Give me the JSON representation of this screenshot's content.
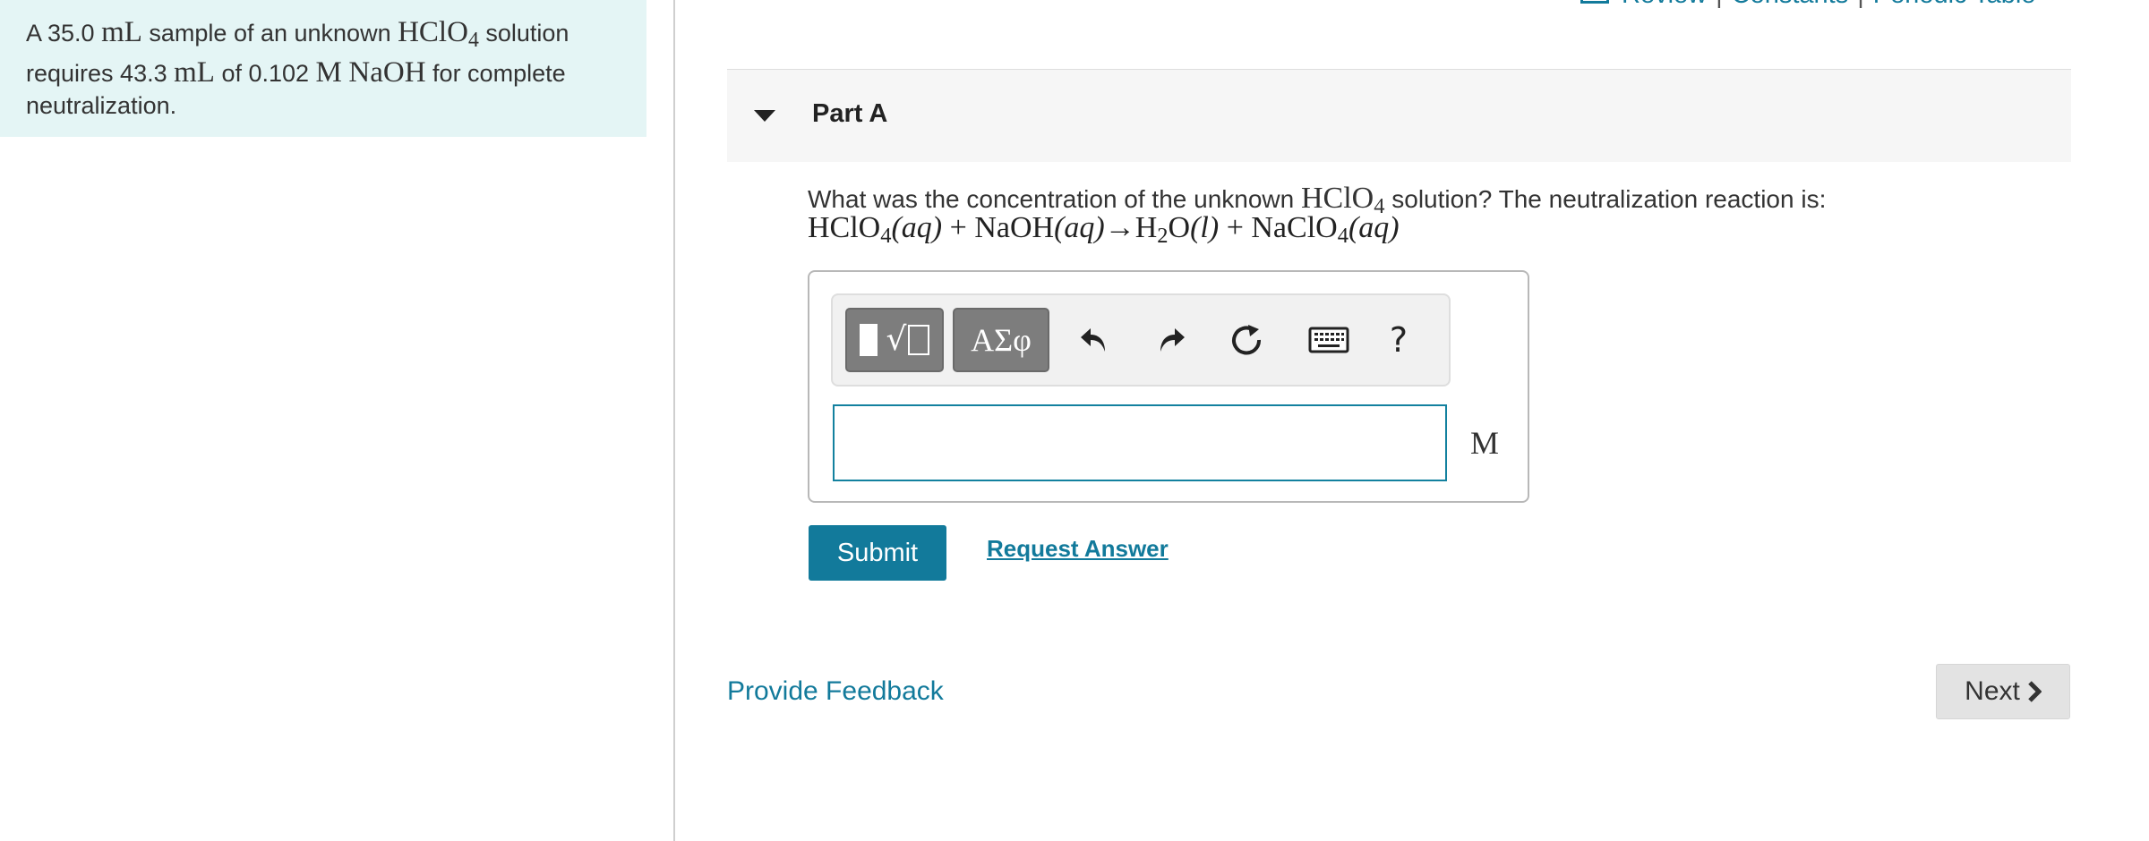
{
  "problem": {
    "t1": "A 35.0 ",
    "u1": "mL",
    "t2": " sample of an unknown ",
    "chem1": "HClO",
    "chem1_sub": "4",
    "t3": " solution requires 43.3 ",
    "u2": "mL",
    "t4": " of 0.102 ",
    "u3": "M",
    "t5": " ",
    "chem2": "NaOH",
    "t6": " for complete neutralization."
  },
  "top_links": {
    "review": "Review",
    "constants": "Constants",
    "periodic_table": "Periodic Table",
    "separator": "|"
  },
  "part": {
    "title": "Part A"
  },
  "question": {
    "t1": "What was the concentration of the unknown ",
    "chem": "HClO",
    "chem_sub": "4",
    "t2": " solution? The neutralization reaction is:"
  },
  "equation": {
    "r1": "HClO",
    "r1_sub": "4",
    "r1_state": "(aq)",
    "plus1": " + ",
    "r2": "NaOH",
    "r2_state": "(aq)",
    "arrow": "→",
    "p1": "H",
    "p1_sub": "2",
    "p1b": "O",
    "p1_state": "(l)",
    "plus2": " + ",
    "p2": "NaClO",
    "p2_sub": "4",
    "p2_state": "(aq)"
  },
  "toolbar": {
    "greek_label": "ΑΣφ",
    "help_label": "?"
  },
  "answer": {
    "value": "",
    "unit": "M"
  },
  "actions": {
    "submit": "Submit",
    "request_answer": "Request Answer",
    "provide_feedback": "Provide Feedback",
    "next": "Next"
  },
  "colors": {
    "accent": "#127a9b",
    "panel_bg": "#e4f5f5"
  }
}
